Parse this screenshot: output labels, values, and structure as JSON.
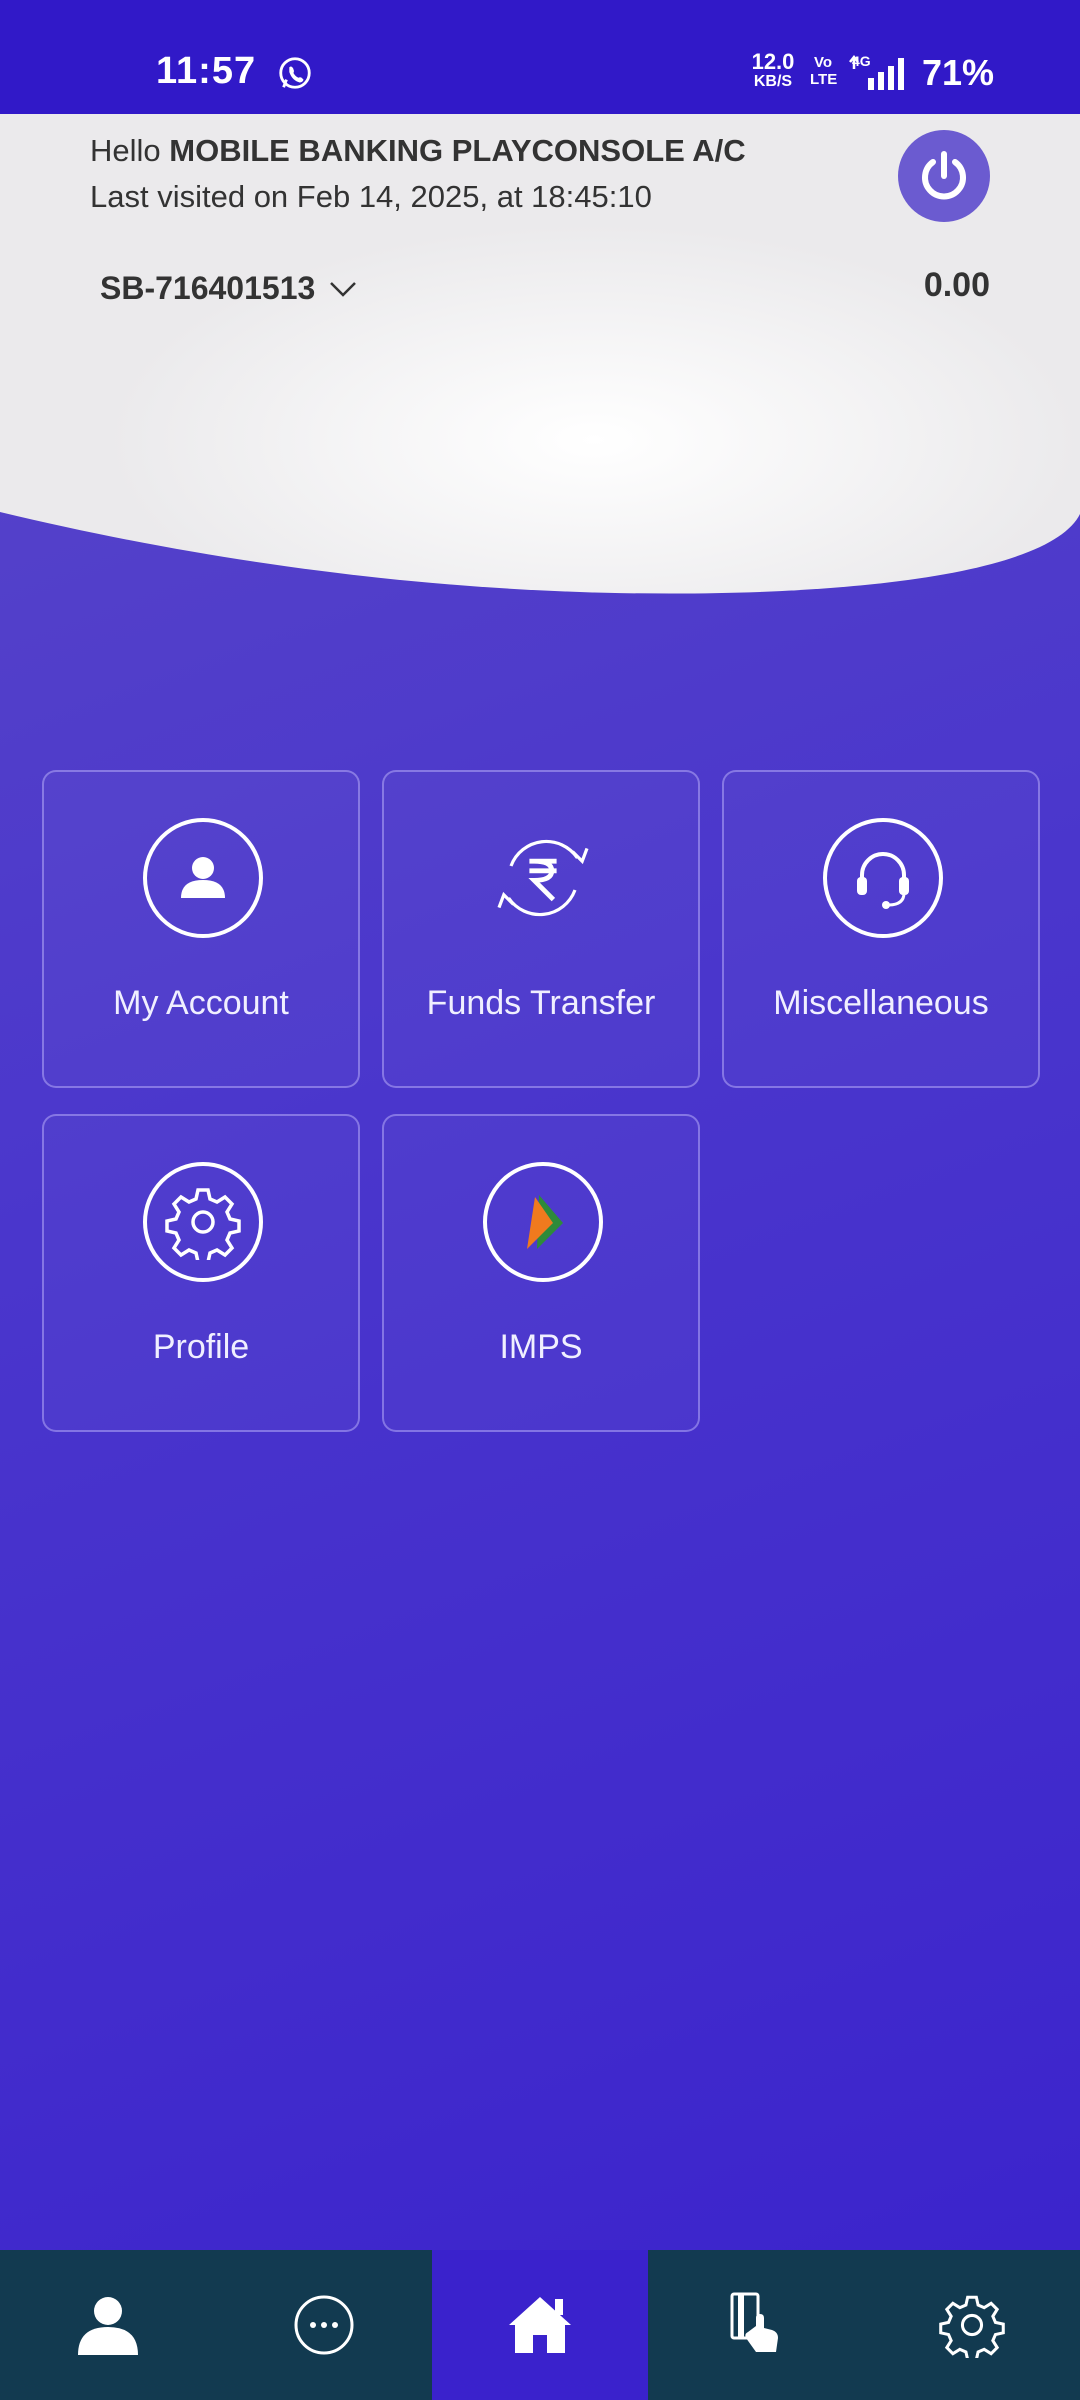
{
  "status_bar": {
    "time": "11:57",
    "net_speed_value": "12.0",
    "net_speed_unit": "KB/S",
    "volte_top": "Vo",
    "volte_bottom": "LTE",
    "network": "4G",
    "battery": "71%"
  },
  "header": {
    "greeting_prefix": "Hello ",
    "user_name": "MOBILE BANKING PLAYCONSOLE A/C",
    "last_visited": "Last visited on Feb 14, 2025, at 18:45:10",
    "account_number": "SB-716401513",
    "balance": "0.00"
  },
  "tiles": [
    {
      "label": "My Account",
      "icon": "user-icon"
    },
    {
      "label": "Funds Transfer",
      "icon": "rupee-transfer-icon"
    },
    {
      "label": "Miscellaneous",
      "icon": "headset-icon"
    },
    {
      "label": "Profile",
      "icon": "gear-icon"
    },
    {
      "label": "IMPS",
      "icon": "imps-logo-icon"
    }
  ],
  "bottom_nav": [
    {
      "icon": "user-icon",
      "active": false
    },
    {
      "icon": "more-icon",
      "active": false
    },
    {
      "icon": "home-icon",
      "active": true
    },
    {
      "icon": "card-tap-icon",
      "active": false
    },
    {
      "icon": "settings-icon",
      "active": false
    }
  ],
  "colors": {
    "status_bar": "#3119c8",
    "background": "#4a36cc",
    "bottom_nav": "#123a50",
    "nav_active": "#3a22cc",
    "power_button": "#6b5bd0"
  }
}
